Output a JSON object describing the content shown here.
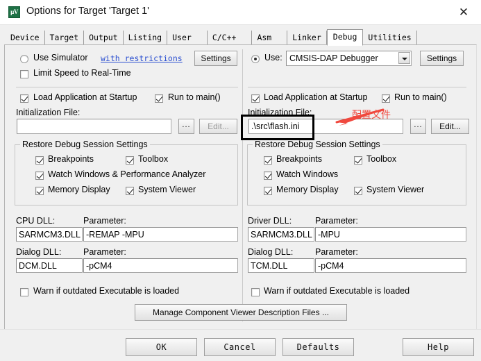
{
  "window": {
    "title": "Options for Target 'Target 1'",
    "icon_name": "keil-uvision-icon",
    "icon_glyph": "µV",
    "close_glyph": "✕",
    "accent_color": "#1e7145",
    "annotation_color": "#f0483e"
  },
  "tabs": [
    {
      "label": "Device",
      "active": false
    },
    {
      "label": "Target",
      "active": false
    },
    {
      "label": "Output",
      "active": false
    },
    {
      "label": "Listing",
      "active": false
    },
    {
      "label": "User",
      "active": false
    },
    {
      "label": "C/C++",
      "active": false
    },
    {
      "label": "Asm",
      "active": false
    },
    {
      "label": "Linker",
      "active": false
    },
    {
      "label": "Debug",
      "active": true
    },
    {
      "label": "Utilities",
      "active": false
    }
  ],
  "left": {
    "use_simulator": {
      "label": "Use Simulator",
      "checked": false
    },
    "with_restrictions": "with restrictions",
    "settings_button": "Settings",
    "limit_speed": {
      "label": "Limit Speed to Real-Time",
      "checked": false
    },
    "load_app": {
      "label": "Load Application at Startup",
      "checked": true
    },
    "run_to_main": {
      "label": "Run to main()",
      "checked": true
    },
    "init_file_label": "Initialization File:",
    "init_file_value": "",
    "browse_button": "...",
    "edit_button": "Edit...",
    "edit_enabled": false,
    "restore_group": {
      "title": "Restore Debug Session Settings",
      "items": [
        {
          "label": "Breakpoints",
          "checked": true
        },
        {
          "label": "Toolbox",
          "checked": true
        },
        {
          "label": "Watch Windows & Performance Analyzer",
          "checked": true
        },
        {
          "label": "Memory Display",
          "checked": true
        },
        {
          "label": "System Viewer",
          "checked": true
        }
      ]
    },
    "cpu_dll_label": "CPU DLL:",
    "cpu_dll_value": "SARMCM3.DLL",
    "cpu_param_label": "Parameter:",
    "cpu_param_value": "-REMAP -MPU",
    "dialog_dll_label": "Dialog DLL:",
    "dialog_dll_value": "DCM.DLL",
    "dialog_param_label": "Parameter:",
    "dialog_param_value": "-pCM4",
    "warn_outdated": {
      "label": "Warn if outdated Executable is loaded",
      "checked": false
    }
  },
  "right": {
    "use_label": "Use:",
    "use_checked": true,
    "debugger_selected": "CMSIS-DAP Debugger",
    "settings_button": "Settings",
    "load_app": {
      "label": "Load Application at Startup",
      "checked": true
    },
    "run_to_main": {
      "label": "Run to main()",
      "checked": true
    },
    "init_file_label": "Initialization File:",
    "init_file_value": ".\\src\\flash.ini",
    "browse_button": "...",
    "edit_button": "Edit...",
    "edit_enabled": true,
    "restore_group": {
      "title": "Restore Debug Session Settings",
      "items": [
        {
          "label": "Breakpoints",
          "checked": true
        },
        {
          "label": "Toolbox",
          "checked": true
        },
        {
          "label": "Watch Windows",
          "checked": true
        },
        {
          "label": "Memory Display",
          "checked": true
        },
        {
          "label": "System Viewer",
          "checked": true
        }
      ]
    },
    "driver_dll_label": "Driver DLL:",
    "driver_dll_value": "SARMCM3.DLL",
    "driver_param_label": "Parameter:",
    "driver_param_value": "-MPU",
    "dialog_dll_label": "Dialog DLL:",
    "dialog_dll_value": "TCM.DLL",
    "dialog_param_label": "Parameter:",
    "dialog_param_value": "-pCM4",
    "warn_outdated": {
      "label": "Warn if outdated Executable is loaded",
      "checked": false
    }
  },
  "manage_button": "Manage Component Viewer Description Files ...",
  "footer": {
    "ok": "OK",
    "cancel": "Cancel",
    "defaults": "Defaults",
    "help": "Help"
  },
  "annotation": {
    "text": "配置文件",
    "target": "right-init-file-input"
  }
}
